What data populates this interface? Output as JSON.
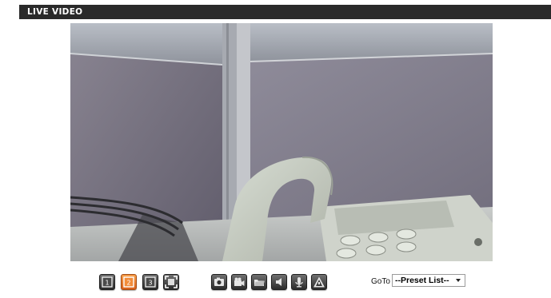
{
  "header": {
    "title": "LIVE VIDEO"
  },
  "toolbar": {
    "layout_buttons": [
      {
        "label": "1",
        "icon": "single-view-icon",
        "active": false
      },
      {
        "label": "2",
        "icon": "dual-view-icon",
        "active": true
      },
      {
        "label": "3",
        "icon": "triple-view-icon",
        "active": false
      }
    ],
    "fullscreen_icon": "fullscreen-icon",
    "action_icons": [
      "snapshot-camera-icon",
      "video-record-icon",
      "folder-icon",
      "speaker-icon",
      "microphone-icon",
      "alert-icon"
    ],
    "goto_label": "GoTo",
    "preset_select": {
      "value": "--Preset List--"
    }
  },
  "colors": {
    "header_bg": "#2a2a2a",
    "active_button": "#e97a2c",
    "button_dark": "#2b2b2b"
  }
}
